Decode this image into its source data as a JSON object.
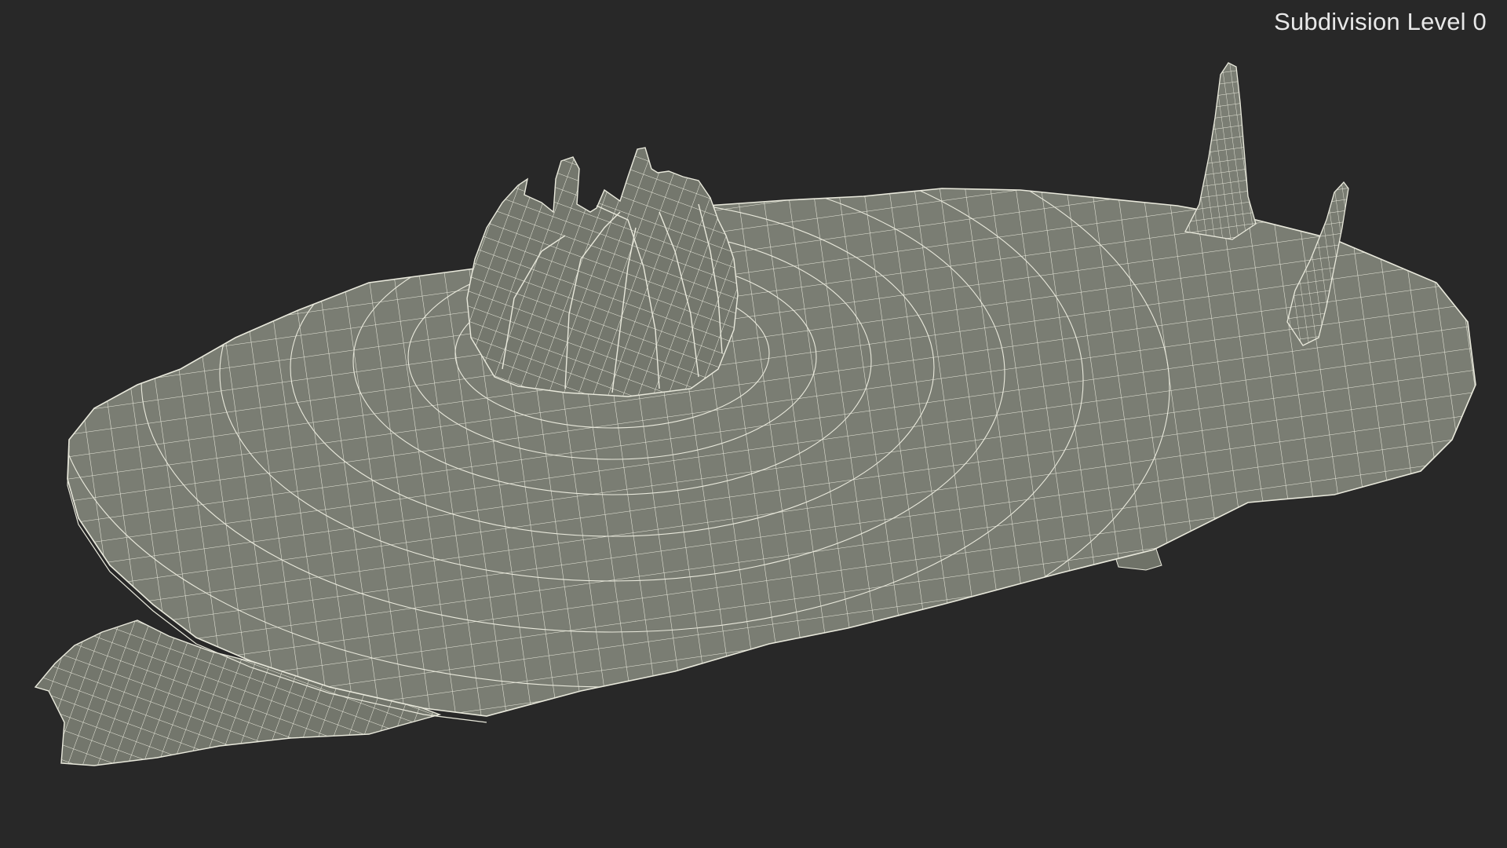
{
  "viewport": {
    "background_color": "#282828",
    "overlay_label": "Subdivision Level 0"
  },
  "model": {
    "subject": "sea slug (nudibranch) 3D model",
    "display_mode": "wireframe on shaded",
    "surface_color": "#777a70",
    "wire_color": "#e9e9dc"
  }
}
